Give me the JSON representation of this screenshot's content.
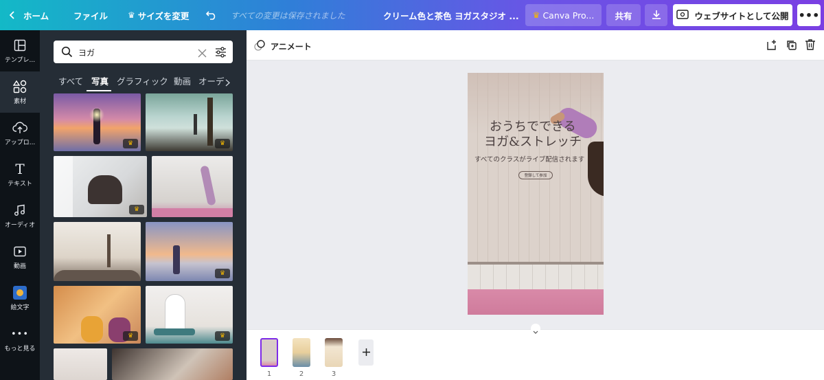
{
  "topbar": {
    "home": "ホーム",
    "file": "ファイル",
    "resize": "サイズを変更",
    "saved_status": "すべての変更は保存されました",
    "doc_title": "クリーム色と茶色 ヨガスタジオ ...",
    "canva_pro": "Canva Pro...",
    "share": "共有",
    "publish": "ウェブサイトとして公開"
  },
  "rail": {
    "items": [
      {
        "label": "テンプレ...",
        "icon": "template-icon"
      },
      {
        "label": "素材",
        "icon": "elements-icon"
      },
      {
        "label": "アップロ...",
        "icon": "upload-cloud-icon"
      },
      {
        "label": "テキスト",
        "icon": "text-icon"
      },
      {
        "label": "オーディオ",
        "icon": "music-note-icon"
      },
      {
        "label": "動画",
        "icon": "video-play-icon"
      },
      {
        "label": "絵文字",
        "icon": "emoji-icon"
      },
      {
        "label": "もっと見る",
        "icon": "more-dots-icon"
      }
    ]
  },
  "panel": {
    "search_value": "ヨガ",
    "tabs": [
      "すべて",
      "写真",
      "グラフィック",
      "動画",
      "オーデ"
    ]
  },
  "editor": {
    "animate": "アニメート"
  },
  "design": {
    "headline_line1": "おうちでできる",
    "headline_line2": "ヨガ&ストレッチ",
    "subtitle": "すべてのクラスがライブ配信されます",
    "button": "登録して参加"
  },
  "pages": [
    "1",
    "2",
    "3"
  ],
  "colors": {
    "accent_pro": "#f5b800",
    "panel_bg": "#252d36",
    "rail_bg": "#0e1318"
  }
}
